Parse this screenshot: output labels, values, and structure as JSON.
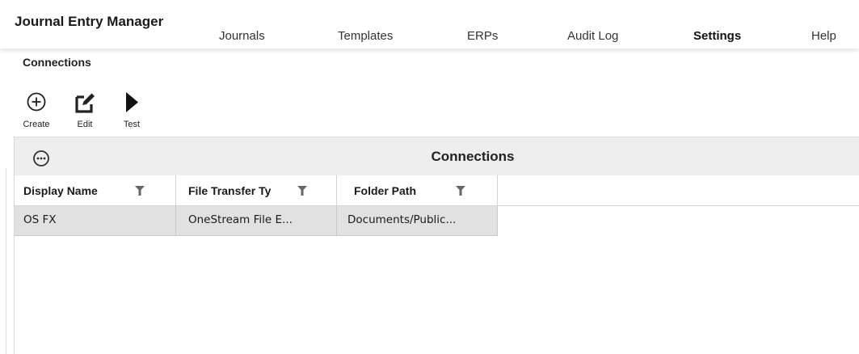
{
  "app": {
    "title": "Journal Entry Manager"
  },
  "nav": {
    "items": [
      {
        "label": "Journals"
      },
      {
        "label": "Templates"
      },
      {
        "label": "ERPs"
      },
      {
        "label": "Audit Log"
      },
      {
        "label": "Settings",
        "active": true
      },
      {
        "label": "Help"
      }
    ]
  },
  "page": {
    "section_title": "Connections"
  },
  "toolbar": {
    "create": {
      "label": "Create",
      "icon": "plus-circle-icon"
    },
    "edit": {
      "label": "Edit",
      "icon": "edit-icon"
    },
    "test": {
      "label": "Test",
      "icon": "play-icon"
    }
  },
  "grid": {
    "title": "Connections",
    "menu_icon": "more-horizontal-circle-icon",
    "columns": [
      {
        "label": "Display Name"
      },
      {
        "label": "File Transfer Ty"
      },
      {
        "label": "Folder Path"
      }
    ],
    "rows": [
      {
        "cells": [
          "OS FX",
          "OneStream File E...",
          "Documents/Public..."
        ],
        "selected": true
      }
    ]
  },
  "colors": {
    "header_bg": "#eeeeee",
    "selected_row_bg": "#e1e1e1",
    "filter_icon": "#666666"
  }
}
